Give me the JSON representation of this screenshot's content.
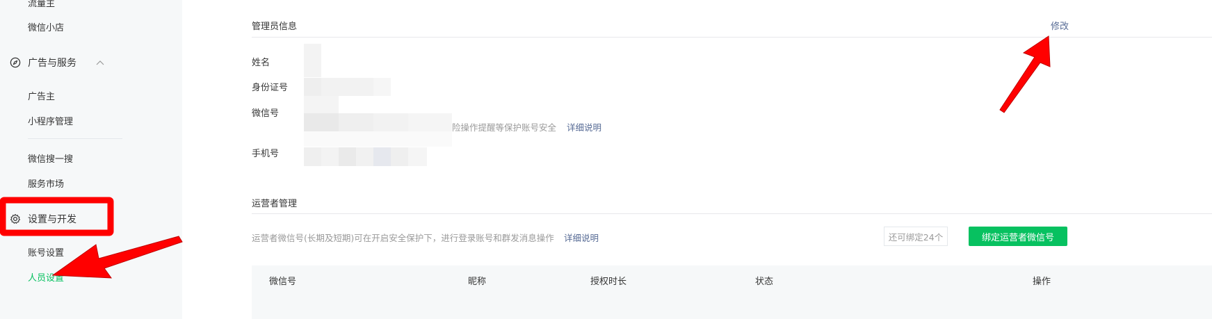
{
  "sidebar": {
    "items_top": [
      {
        "label": "流量主"
      },
      {
        "label": "微信小店"
      }
    ],
    "group_ads": {
      "label": "广告与服务",
      "icon": "compass-icon"
    },
    "items_ads": [
      {
        "label": "广告主"
      },
      {
        "label": "小程序管理"
      },
      {
        "label": "微信搜一搜"
      },
      {
        "label": "服务市场"
      }
    ],
    "group_settings": {
      "label": "设置与开发",
      "icon": "gear-icon"
    },
    "items_settings": [
      {
        "label": "账号设置"
      },
      {
        "label": "人员设置"
      }
    ]
  },
  "admin": {
    "title": "管理员信息",
    "modify_label": "修改",
    "fields": [
      {
        "label": "姓名"
      },
      {
        "label": "身份证号"
      },
      {
        "label": "微信号"
      },
      {
        "label": "手机号"
      }
    ],
    "wechat_hint": "险操作提醒等保护账号安全",
    "wechat_hint_link": "详细说明"
  },
  "operators": {
    "title": "运营者管理",
    "desc": "运营者微信号(长期及短期)可在开启安全保护下，进行登录账号和群发消息操作",
    "desc_link": "详细说明",
    "remaining": "还可绑定24个",
    "bind_button": "绑定运营者微信号",
    "columns": [
      "微信号",
      "昵称",
      "授权时长",
      "状态",
      "操作"
    ]
  },
  "colors": {
    "accent": "#07c160",
    "link": "#576b95",
    "annotation": "#ff0000"
  }
}
